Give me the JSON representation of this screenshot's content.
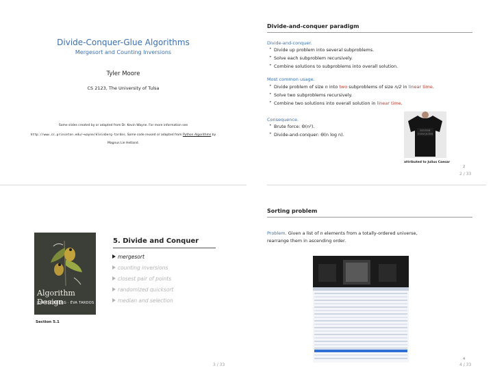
{
  "slides": {
    "title": {
      "title": "Divide-Conquer-Glue Algorithms",
      "subtitle": "Mergesort and Counting Inversions",
      "author": "Tyler Moore",
      "affiliation": "CS 2123, The University of Tulsa",
      "note_line1": "Some slides created by or adapted from Dr. Kevin Wayne. For more information see",
      "note_url": "http://www.cs.princeton.edu/~wayne/kleinberg-tardos",
      "note_line2a": ". Some code reused or adapted from ",
      "note_link": "Python Algorithms",
      "note_line2b": " by",
      "note_line3": "Magnus Lie Hetland."
    },
    "paradigm": {
      "title": "Divide-and-conquer paradigm",
      "block1_title": "Divide-and-conquer.",
      "block1_items": [
        "Divide up problem into several subproblems.",
        "Solve each subproblem recursively.",
        "Combine solutions to subproblems into overall solution."
      ],
      "block2_title": "Most common usage.",
      "b2_i1_a": "Divide problem of size ",
      "b2_i1_n": "n",
      "b2_i1_b": " into ",
      "b2_i1_two": "two",
      "b2_i1_c": " subproblems of size ",
      "b2_i1_half": "n/2",
      "b2_i1_d": " in ",
      "b2_i1_lin": "linear time",
      "b2_i1_e": ".",
      "b2_i2": "Solve two subproblems recursively.",
      "b2_i3_a": "Combine two solutions into overall solution in ",
      "b2_i3_lin": "linear time",
      "b2_i3_b": ".",
      "block3_title": "Consequence.",
      "b3_i1": "Brute force:  Θ(n²).",
      "b3_i2": "Divide-and-conquer:  Θ(n log n).",
      "tshirt_text": "DIVIDE AND CONQUER",
      "caption": "attributed to Julius Caesar",
      "inner_page": "2",
      "page": "2 / 33"
    },
    "book": {
      "book_title": "Algorithm Design",
      "book_authors": "JON KLEINBERG · ÉVA TARDOS",
      "chapter": "5. Divide and Conquer",
      "toc": [
        "mergesort",
        "counting inversions",
        "closest pair of points",
        "randomized quicksort",
        "median and selection"
      ],
      "section": "Section 5.1",
      "page": "3 / 33"
    },
    "sorting": {
      "title": "Sorting problem",
      "problem_label": "Problem.",
      "problem_text_a": " Given a list of ",
      "problem_n": "n",
      "problem_text_b": " elements from a totally-ordered universe,",
      "problem_text_c": "rearrange them in ascending order.",
      "inner_page": "4",
      "page": "4 / 33"
    }
  },
  "colors": {
    "accent": "#3a6fb0",
    "highlight": "#c0392b"
  }
}
